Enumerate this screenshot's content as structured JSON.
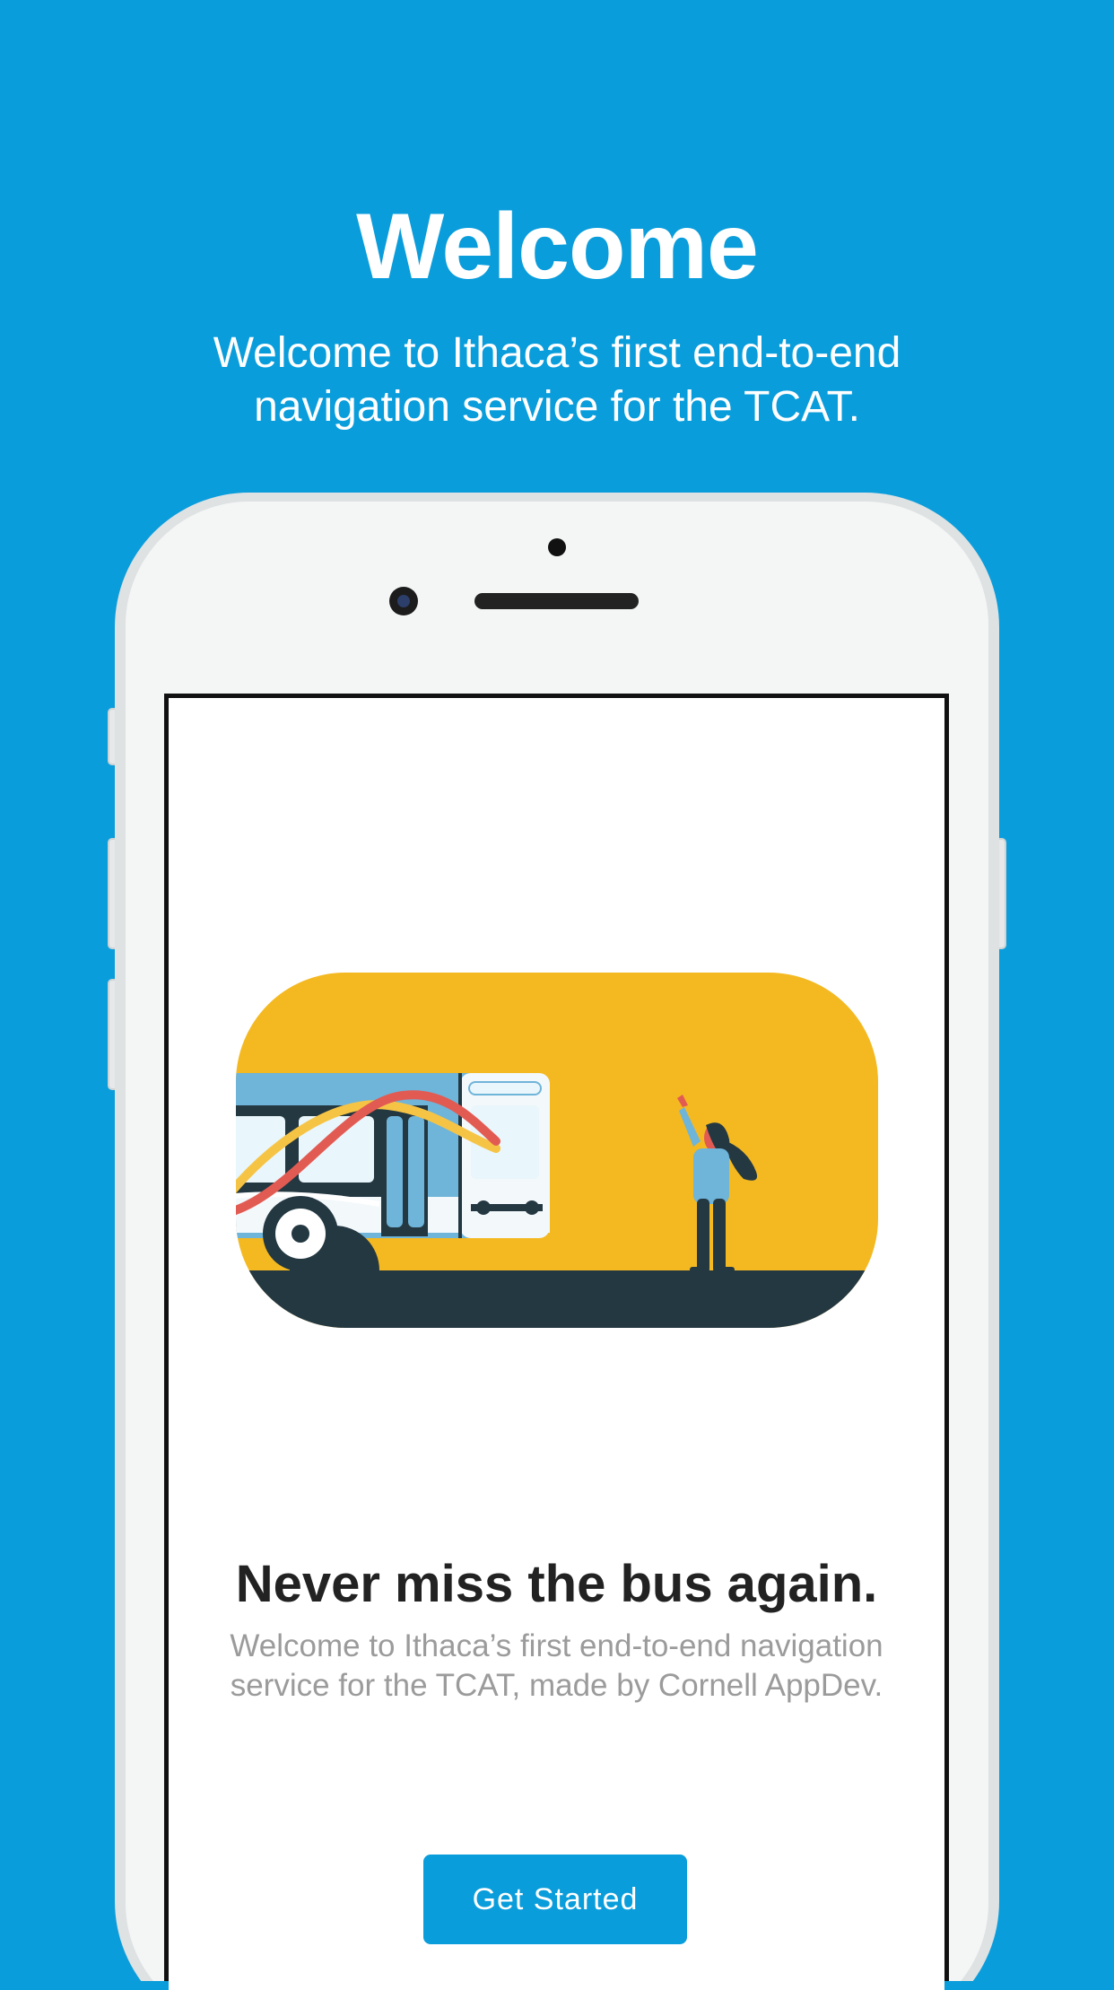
{
  "header": {
    "title": "Welcome",
    "subtitle": "Welcome to Ithaca’s first end-to-end navigation service for the TCAT."
  },
  "onboarding": {
    "title": "Never miss the bus again.",
    "body": "Welcome to Ithaca’s first end-to-end navigation service for the TCAT, made by Cornell AppDev.",
    "button_label": "Get Started"
  },
  "colors": {
    "background": "#0a9ddb",
    "accent": "#0a9ddb",
    "illustration_background": "#f4b921",
    "road": "#243842",
    "bus_body": "#6fb4d9"
  },
  "icons": {
    "illustration": "bus-and-waving-person-illustration"
  }
}
